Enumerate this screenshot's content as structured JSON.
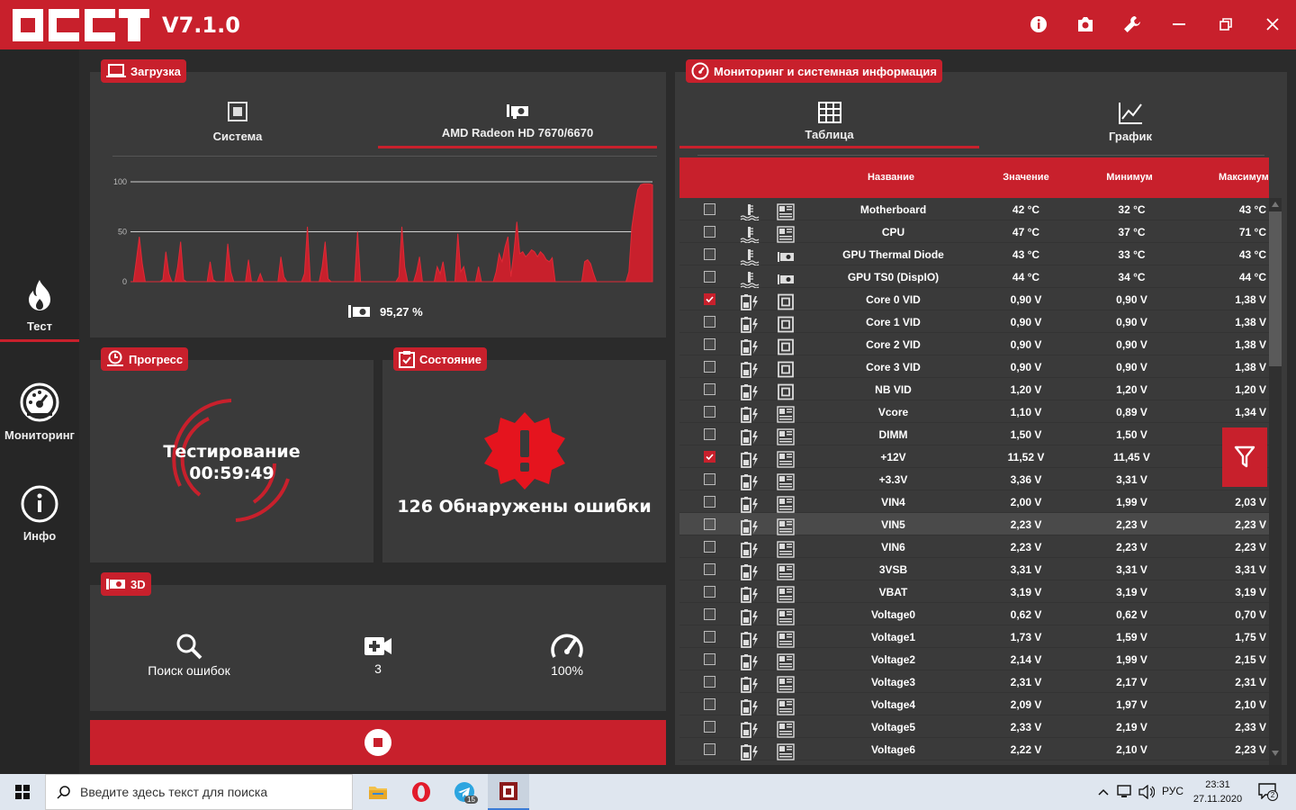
{
  "app": {
    "version": "V7.1.0"
  },
  "nav": {
    "test": "Тест",
    "monitoring": "Мониторинг",
    "info": "Инфо"
  },
  "load": {
    "tag": "Загрузка",
    "tabs": [
      "Система",
      "AMD Radeon HD 7670/6670"
    ],
    "active_tab": 1,
    "value_text": "95,27 %"
  },
  "chart_data": {
    "type": "area",
    "ylim": [
      0,
      100
    ],
    "y_ticks": [
      0,
      50,
      100
    ],
    "color": "#c8202c",
    "values": [
      0,
      0,
      22,
      45,
      18,
      0,
      0,
      0,
      0,
      0,
      0,
      2,
      30,
      8,
      0,
      0,
      15,
      40,
      2,
      0,
      0,
      0,
      0,
      0,
      0,
      0,
      0,
      20,
      2,
      0,
      0,
      0,
      0,
      38,
      10,
      0,
      0,
      0,
      0,
      0,
      22,
      0,
      0,
      0,
      8,
      0,
      0,
      0,
      0,
      0,
      0,
      25,
      5,
      0,
      0,
      0,
      0,
      0,
      0,
      8,
      55,
      0,
      0,
      0,
      0,
      15,
      40,
      3,
      0,
      0,
      0,
      0,
      0,
      0,
      0,
      0,
      0,
      50,
      0,
      0,
      0,
      0,
      0,
      0,
      0,
      0,
      0,
      0,
      0,
      0,
      0,
      5,
      55,
      15,
      0,
      0,
      0,
      10,
      25,
      0,
      0,
      0,
      0,
      0,
      15,
      8,
      20,
      0,
      0,
      0,
      0,
      48,
      10,
      15,
      0,
      0,
      0,
      0,
      15,
      0,
      0,
      0,
      0,
      0,
      10,
      28,
      20,
      35,
      45,
      5,
      30,
      60,
      28,
      30,
      25,
      28,
      32,
      30,
      25,
      30,
      27,
      22,
      20,
      24,
      0,
      0,
      0,
      0,
      0,
      0,
      0,
      0,
      0,
      0,
      20,
      22,
      18,
      8,
      0,
      0,
      0,
      0,
      0,
      0,
      0,
      0,
      0,
      0,
      0,
      10,
      55,
      75,
      92,
      97,
      98,
      98,
      98,
      97
    ]
  },
  "progress": {
    "tag": "Прогресс",
    "status": "Тестирование",
    "time": "00:59:49"
  },
  "state": {
    "tag": "Состояние",
    "message": "126 Обнаружены ошибки"
  },
  "test3d": {
    "tag": "3D",
    "items": [
      {
        "icon": "search-icon",
        "label": "Поиск ошибок"
      },
      {
        "icon": "camera-plus-icon",
        "label": "3"
      },
      {
        "icon": "speedometer-icon",
        "label": "100%"
      }
    ]
  },
  "monitoring": {
    "tag": "Мониторинг и системная информация",
    "tabs": [
      "Таблица",
      "График"
    ],
    "active_tab": 0,
    "columns": {
      "name": "Название",
      "value": "Значение",
      "min": "Минимум",
      "max": "Максимум"
    },
    "rows": [
      {
        "checked": false,
        "kind": "temp",
        "src": "mb",
        "name": "Motherboard",
        "value": "42 °C",
        "min": "32 °C",
        "max": "43 °C"
      },
      {
        "checked": false,
        "kind": "temp",
        "src": "mb",
        "name": "CPU",
        "value": "47 °C",
        "min": "37 °C",
        "max": "71 °C"
      },
      {
        "checked": false,
        "kind": "temp",
        "src": "gpu",
        "name": "GPU Thermal Diode",
        "value": "43 °C",
        "min": "33 °C",
        "max": "43 °C"
      },
      {
        "checked": false,
        "kind": "temp",
        "src": "gpu",
        "name": "GPU TS0 (DispIO)",
        "value": "44 °C",
        "min": "34 °C",
        "max": "44 °C"
      },
      {
        "checked": true,
        "kind": "volt",
        "src": "cpu",
        "name": "Core 0 VID",
        "value": "0,90 V",
        "min": "0,90 V",
        "max": "1,38 V"
      },
      {
        "checked": false,
        "kind": "volt",
        "src": "cpu",
        "name": "Core 1 VID",
        "value": "0,90 V",
        "min": "0,90 V",
        "max": "1,38 V"
      },
      {
        "checked": false,
        "kind": "volt",
        "src": "cpu",
        "name": "Core 2 VID",
        "value": "0,90 V",
        "min": "0,90 V",
        "max": "1,38 V"
      },
      {
        "checked": false,
        "kind": "volt",
        "src": "cpu",
        "name": "Core 3 VID",
        "value": "0,90 V",
        "min": "0,90 V",
        "max": "1,38 V"
      },
      {
        "checked": false,
        "kind": "volt",
        "src": "cpu",
        "name": "NB VID",
        "value": "1,20 V",
        "min": "1,20 V",
        "max": "1,20 V"
      },
      {
        "checked": false,
        "kind": "volt",
        "src": "mb",
        "name": "Vcore",
        "value": "1,10 V",
        "min": "0,89 V",
        "max": "1,34 V"
      },
      {
        "checked": false,
        "kind": "volt",
        "src": "mb",
        "name": "DIMM",
        "value": "1,50 V",
        "min": "1,50 V",
        "max": ""
      },
      {
        "checked": true,
        "kind": "volt",
        "src": "mb",
        "name": "+12V",
        "value": "11,52 V",
        "min": "11,45 V",
        "max": ""
      },
      {
        "checked": false,
        "kind": "volt",
        "src": "mb",
        "name": "+3.3V",
        "value": "3,36 V",
        "min": "3,31 V",
        "max": ""
      },
      {
        "checked": false,
        "kind": "volt",
        "src": "mb",
        "name": "VIN4",
        "value": "2,00 V",
        "min": "1,99 V",
        "max": "2,03 V"
      },
      {
        "checked": false,
        "kind": "volt",
        "src": "mb",
        "name": "VIN5",
        "value": "2,23 V",
        "min": "2,23 V",
        "max": "2,23 V",
        "highlight": true
      },
      {
        "checked": false,
        "kind": "volt",
        "src": "mb",
        "name": "VIN6",
        "value": "2,23 V",
        "min": "2,23 V",
        "max": "2,23 V"
      },
      {
        "checked": false,
        "kind": "volt",
        "src": "mb",
        "name": "3VSB",
        "value": "3,31 V",
        "min": "3,31 V",
        "max": "3,31 V"
      },
      {
        "checked": false,
        "kind": "volt",
        "src": "mb",
        "name": "VBAT",
        "value": "3,19 V",
        "min": "3,19 V",
        "max": "3,19 V"
      },
      {
        "checked": false,
        "kind": "volt",
        "src": "mb",
        "name": "Voltage0",
        "value": "0,62 V",
        "min": "0,62 V",
        "max": "0,70 V"
      },
      {
        "checked": false,
        "kind": "volt",
        "src": "mb",
        "name": "Voltage1",
        "value": "1,73 V",
        "min": "1,59 V",
        "max": "1,75 V"
      },
      {
        "checked": false,
        "kind": "volt",
        "src": "mb",
        "name": "Voltage2",
        "value": "2,14 V",
        "min": "1,99 V",
        "max": "2,15 V"
      },
      {
        "checked": false,
        "kind": "volt",
        "src": "mb",
        "name": "Voltage3",
        "value": "2,31 V",
        "min": "2,17 V",
        "max": "2,31 V"
      },
      {
        "checked": false,
        "kind": "volt",
        "src": "mb",
        "name": "Voltage4",
        "value": "2,09 V",
        "min": "1,97 V",
        "max": "2,10 V"
      },
      {
        "checked": false,
        "kind": "volt",
        "src": "mb",
        "name": "Voltage5",
        "value": "2,33 V",
        "min": "2,19 V",
        "max": "2,33 V"
      },
      {
        "checked": false,
        "kind": "volt",
        "src": "mb",
        "name": "Voltage6",
        "value": "2,22 V",
        "min": "2,10 V",
        "max": "2,23 V"
      }
    ]
  },
  "taskbar": {
    "search_placeholder": "Введите здесь текст для поиска",
    "telegram_badge": "15",
    "lang": "РУС",
    "time": "23:31",
    "date": "27.11.2020",
    "notifications": "2"
  }
}
